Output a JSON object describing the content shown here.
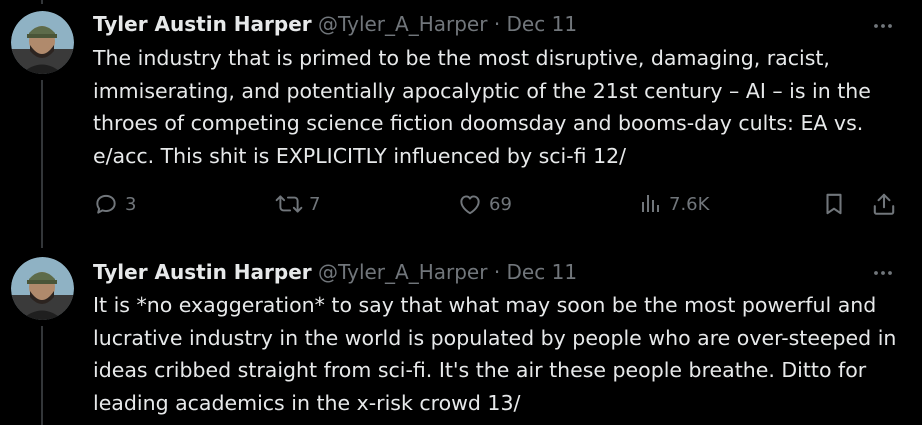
{
  "tweets": [
    {
      "author_name": "Tyler Austin Harper",
      "handle": "@Tyler_A_Harper",
      "separator": "·",
      "date": "Dec 11",
      "text": "The industry that is primed to be the most disruptive, damaging, racist, immiserating, and potentially apocalyptic of the 21st century – AI – is in the throes of competing science fiction doomsday and booms-day cults: EA vs. e/acc. This shit is EXPLICITLY influenced by sci-fi 12/",
      "replies": "3",
      "reposts": "7",
      "likes": "69",
      "views": "7.6K"
    },
    {
      "author_name": "Tyler Austin Harper",
      "handle": "@Tyler_A_Harper",
      "separator": "·",
      "date": "Dec 11",
      "text": "It is *no exaggeration* to say that what may soon be the most powerful and lucrative industry in the world is populated by people who are over-steeped in ideas cribbed straight from sci-fi. It's the air these people breathe. Ditto for leading academics in the x-risk crowd 13/"
    }
  ],
  "icons": {
    "reply": "reply-icon",
    "repost": "repost-icon",
    "like": "heart-icon",
    "views": "views-icon",
    "bookmark": "bookmark-icon",
    "share": "share-icon",
    "more": "more-icon"
  },
  "colors": {
    "background": "#000000",
    "text": "#e7e9ea",
    "muted": "#71767b",
    "thread_line": "#333639"
  }
}
